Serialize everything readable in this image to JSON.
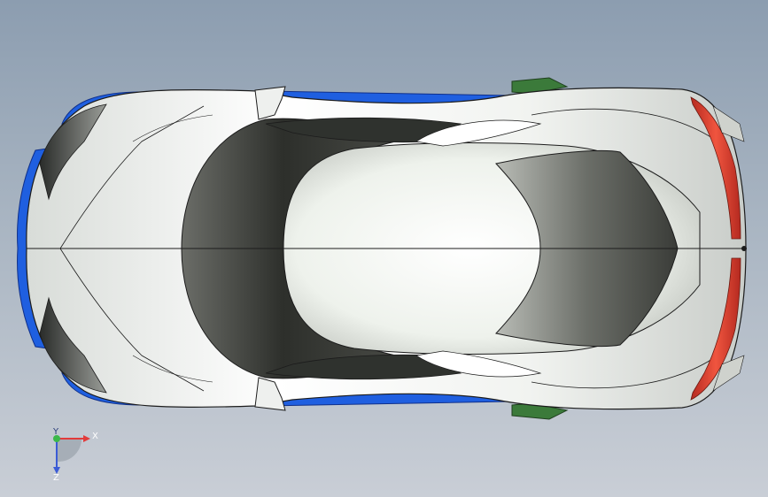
{
  "viewport": {
    "background_top": "#8c9db0",
    "background_bottom": "#c9ced6"
  },
  "model": {
    "body_color": "#f2f4f2",
    "glass_color": "#3c3f3a",
    "side_blue": "#1f5fe0",
    "wheel_green": "#3b7a3a",
    "tail_red": "#d93a2a",
    "edge_color": "#1c1c1c"
  },
  "triad": {
    "x_label": "X",
    "y_label": "Y",
    "z_label": "Z",
    "x_color": "#e23b3b",
    "y_color": "#3bb84a",
    "z_color": "#3b5bd6"
  }
}
